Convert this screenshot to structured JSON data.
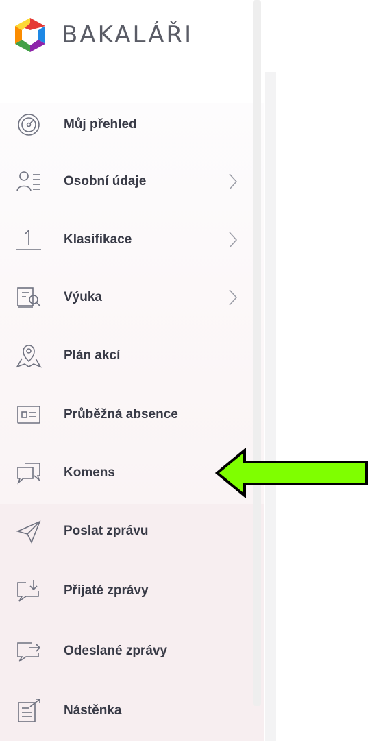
{
  "app": {
    "logo_text": "BAKALÁŘI",
    "logo_colors": [
      "#e53935",
      "#fb8c00",
      "#43a047",
      "#1e88e5",
      "#8e24aa"
    ]
  },
  "menu": {
    "items": [
      {
        "label": "Můj přehled",
        "icon": "gauge-icon",
        "has_submenu": false
      },
      {
        "label": "Osobní údaje",
        "icon": "personal-data-icon",
        "has_submenu": true
      },
      {
        "label": "Klasifikace",
        "icon": "grade-one-icon",
        "has_submenu": true
      },
      {
        "label": "Výuka",
        "icon": "book-search-icon",
        "has_submenu": true
      },
      {
        "label": "Plán akcí",
        "icon": "map-pin-icon",
        "has_submenu": false
      },
      {
        "label": "Průběžná absence",
        "icon": "id-card-icon",
        "has_submenu": false
      },
      {
        "label": "Komens",
        "icon": "chat-bubbles-icon",
        "has_submenu": false
      }
    ],
    "komens_submenu": [
      {
        "label": "Poslat zprávu",
        "icon": "send-icon"
      },
      {
        "label": "Přijaté zprávy",
        "icon": "inbox-message-icon"
      },
      {
        "label": "Odeslané zprávy",
        "icon": "sent-message-icon"
      },
      {
        "label": "Nástěnka",
        "icon": "noticeboard-icon"
      }
    ]
  },
  "annotation": {
    "arrow_color": "#7fff00",
    "points_to": "Komens"
  },
  "colors": {
    "text": "#383a46",
    "icon": "#6f7280",
    "submenu_bg": "#f7eef0"
  }
}
